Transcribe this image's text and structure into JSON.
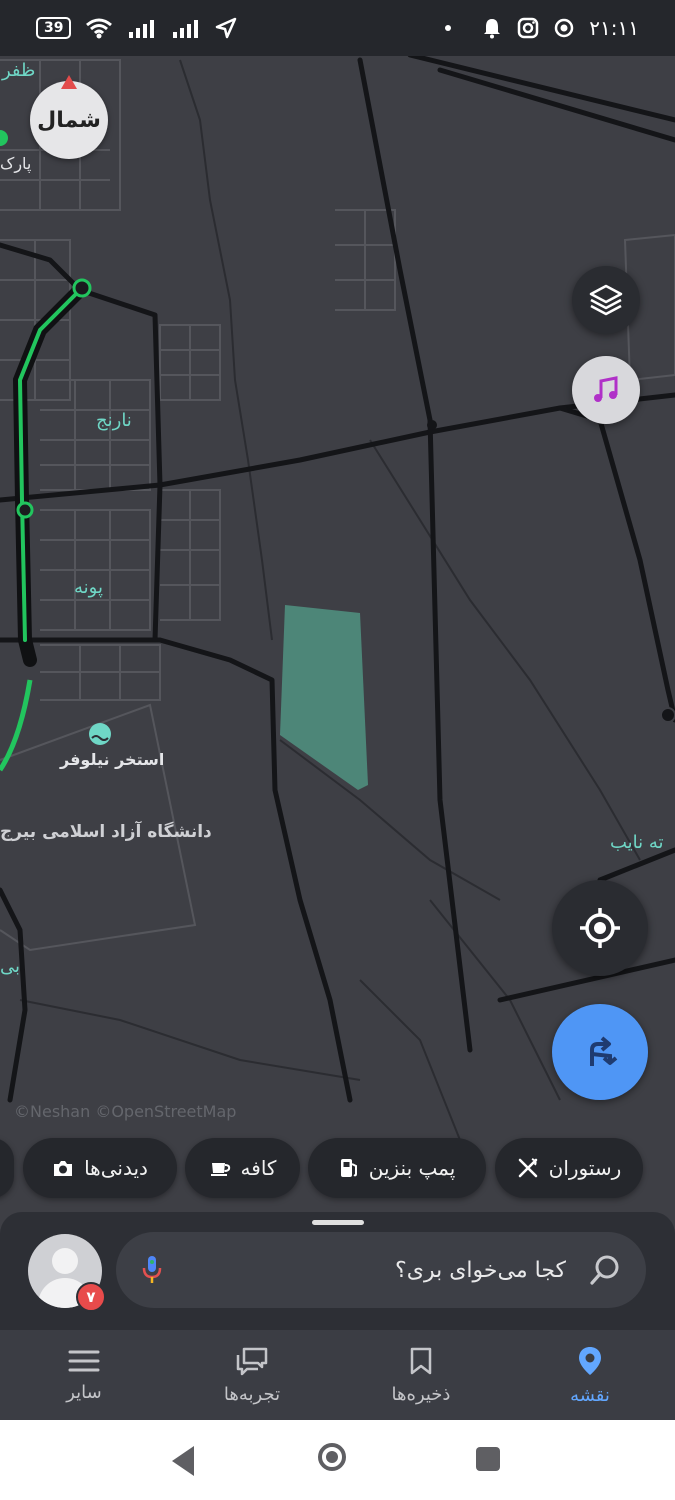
{
  "status_bar": {
    "battery": "39",
    "time": "۲۱:۱۱",
    "icons": [
      "wifi-icon",
      "signal-icon",
      "signal-icon",
      "location-arrow-icon",
      "bell-icon",
      "instagram-icon",
      "vpn-icon"
    ]
  },
  "map": {
    "compass_label": "شمال",
    "labels": {
      "zafar": "ظفر",
      "park": "پارک",
      "narenj": "نارنج",
      "puneh": "پونه",
      "pool": "استخر نیلوفر",
      "university": "دانشگاه آزاد اسلامی بیرج",
      "naib": "ته نایب",
      "edge_b": "بی"
    },
    "attribution": "©Neshan ©OpenStreetMap",
    "colors": {
      "background": "#3e3f45",
      "road": "#141518",
      "route": "#22c55e",
      "park": "#4e8a7b",
      "label": "#6fd7c6"
    }
  },
  "buttons": {
    "layers_icon": "layers-icon",
    "music_icon": "music-note-icon",
    "locate_icon": "crosshair-icon",
    "route_icon": "directions-icon"
  },
  "chips": [
    {
      "label": "رستوران",
      "icon": "fork-knife-icon"
    },
    {
      "label": "پمپ بنزین",
      "icon": "fuel-pump-icon"
    },
    {
      "label": "کافه",
      "icon": "coffee-cup-icon"
    },
    {
      "label": "دیدنی‌ها",
      "icon": "camera-icon"
    }
  ],
  "search": {
    "placeholder": "کجا می‌خوای بری؟",
    "badge_count": "۷"
  },
  "bottom_nav": [
    {
      "label": "نقشه",
      "icon": "map-pin-icon",
      "active": true
    },
    {
      "label": "ذخیره‌ها",
      "icon": "bookmark-icon",
      "active": false
    },
    {
      "label": "تجربه‌ها",
      "icon": "chat-bubbles-icon",
      "active": false
    },
    {
      "label": "سایر",
      "icon": "menu-icon",
      "active": false
    }
  ]
}
